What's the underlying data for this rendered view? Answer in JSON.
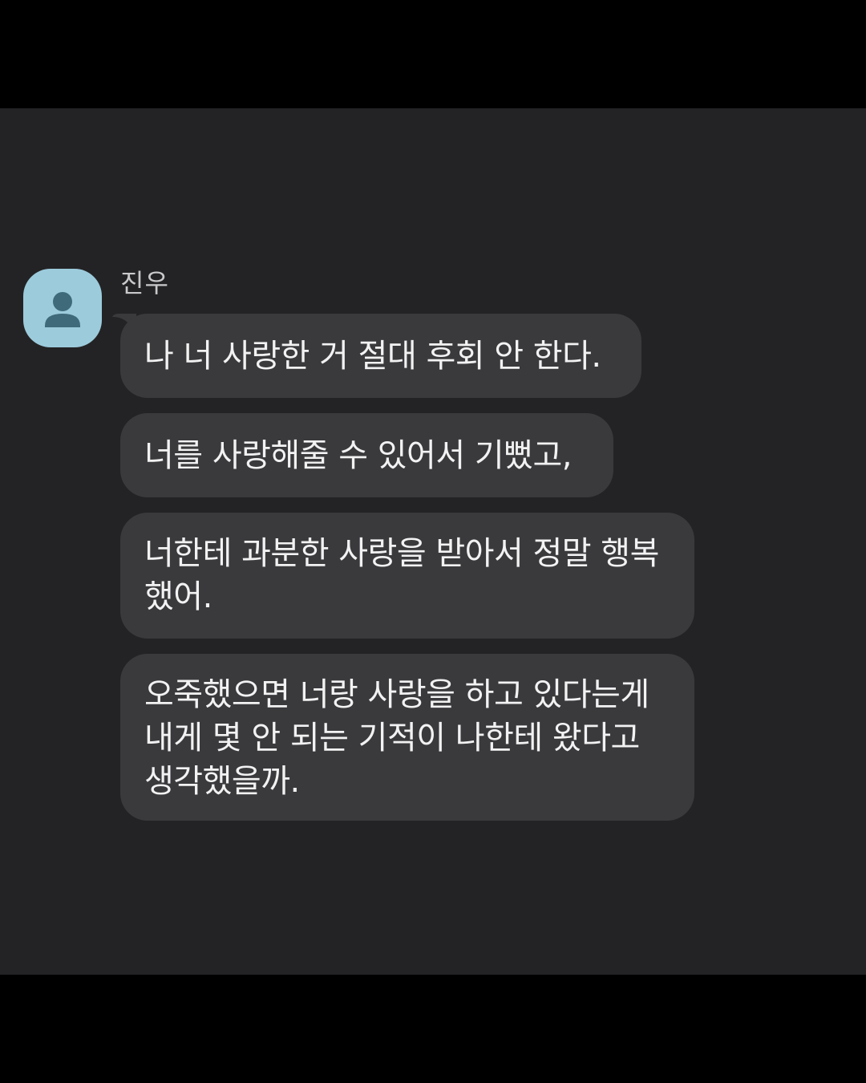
{
  "conversation": {
    "sender": {
      "name": "진우",
      "avatar_icon": "person-icon",
      "avatar_color": "#9ccbdc"
    },
    "messages": [
      {
        "text": "나 너 사랑한 거 절대 후회 안 한다."
      },
      {
        "text": "너를 사랑해줄 수 있어서 기뻤고,"
      },
      {
        "text": "너한테 과분한 사랑을 받아서 정말 행복\n했어."
      },
      {
        "text": "오죽했으면 너랑 사랑을 하고 있다는게\n내게 몇 안 되는 기적이 나한테 왔다고\n생각했을까."
      }
    ]
  },
  "colors": {
    "background": "#232325",
    "bubble": "#3a3a3d",
    "message_text": "#f2f2f3",
    "name_text": "#c9c9cb",
    "letterbox": "#000000"
  }
}
